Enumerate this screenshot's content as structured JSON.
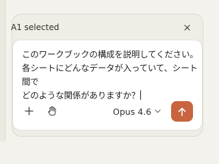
{
  "selection": {
    "label": "A1 selected"
  },
  "composer": {
    "message": "このワークブックの構成を説明してください。\n各シートにどんなデータが入っていて、シート間で\nどのような関係がありますか？"
  },
  "toolbar": {
    "model_label": "Opus 4.6"
  },
  "colors": {
    "send_button": "#c8643f",
    "background": "#f4f2ec"
  },
  "icons": [
    "close-icon",
    "plus-icon",
    "hand-icon",
    "chevron-down-icon",
    "arrow-up-icon"
  ]
}
